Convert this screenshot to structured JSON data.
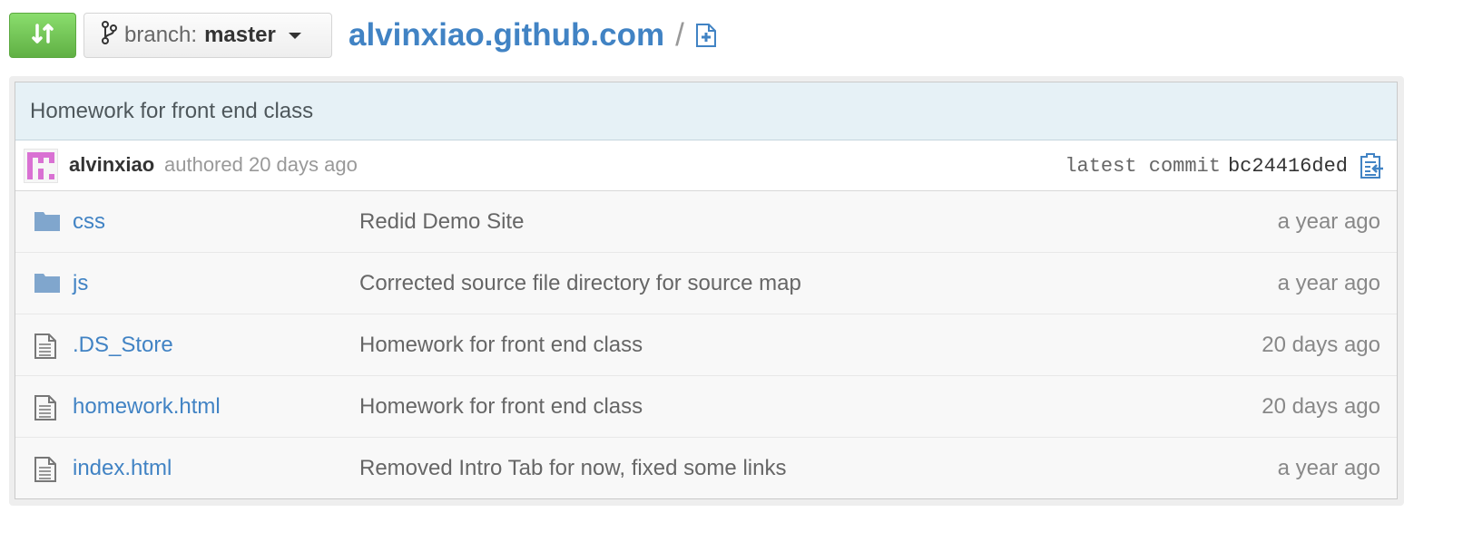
{
  "toolbar": {
    "branch_prefix": "branch:",
    "branch_name": "master"
  },
  "repo": {
    "name": "alvinxiao.github.com",
    "separator": "/"
  },
  "commit": {
    "message": "Homework for front end class",
    "author": "alvinxiao",
    "authored_text": "authored 20 days ago",
    "latest_label": "latest commit",
    "sha": "bc24416ded"
  },
  "files": [
    {
      "name": "css",
      "type": "folder",
      "message": "Redid Demo Site",
      "age": "a year ago"
    },
    {
      "name": "js",
      "type": "folder",
      "message": "Corrected source file directory for source map",
      "age": "a year ago"
    },
    {
      "name": ".DS_Store",
      "type": "file",
      "message": "Homework for front end class",
      "age": "20 days ago"
    },
    {
      "name": "homework.html",
      "type": "file",
      "message": "Homework for front end class",
      "age": "20 days ago"
    },
    {
      "name": "index.html",
      "type": "file",
      "message": "Removed Intro Tab for now, fixed some links",
      "age": "a year ago"
    }
  ],
  "colors": {
    "link": "#4183c4",
    "compare_green": "#6cc644",
    "commit_bar": "#e6f1f6",
    "folder": "#80a6cd"
  },
  "icons": [
    "compare-icon",
    "branch-icon",
    "caret-down-icon",
    "new-file-icon",
    "avatar",
    "clipboard-icon",
    "folder-icon",
    "file-icon"
  ]
}
